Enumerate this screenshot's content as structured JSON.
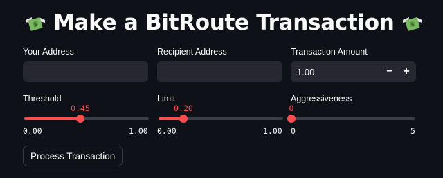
{
  "page": {
    "title": "Make a BitRoute Transaction",
    "title_icon": "money-with-wings-icon"
  },
  "form": {
    "your_address": {
      "label": "Your Address",
      "value": ""
    },
    "recipient_address": {
      "label": "Recipient Address",
      "value": ""
    },
    "amount": {
      "label": "Transaction Amount",
      "value": "1.00",
      "minus": "−",
      "plus": "+"
    },
    "threshold": {
      "label": "Threshold",
      "value": 0.45,
      "value_text": "0.45",
      "min": "0.00",
      "max": "1.00",
      "fraction": 0.45
    },
    "limit": {
      "label": "Limit",
      "value": 0.2,
      "value_text": "0.20",
      "min": "0.00",
      "max": "1.00",
      "fraction": 0.2
    },
    "aggressiveness": {
      "label": "Aggressiveness",
      "value": 0,
      "value_text": "0",
      "min": "0",
      "max": "5",
      "fraction": 0.0
    },
    "submit_label": "Process Transaction"
  },
  "colors": {
    "background": "#0e1117",
    "input_bg": "#262730",
    "accent": "#ff4b4b",
    "track": "#3d3f48",
    "text": "#fafafa"
  }
}
